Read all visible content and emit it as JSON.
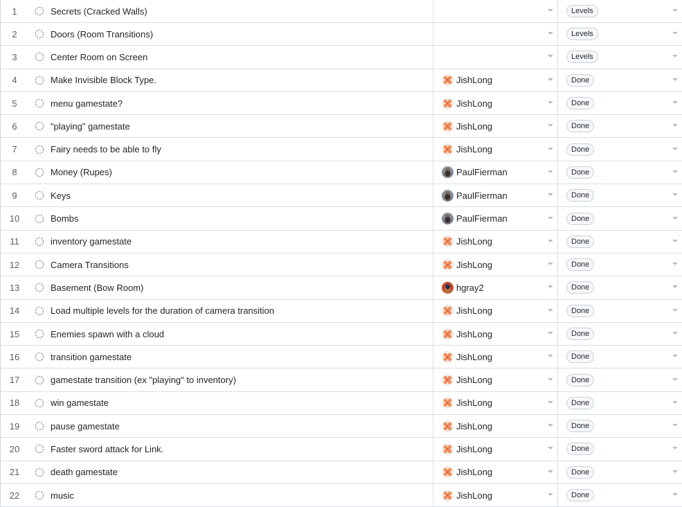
{
  "rows": [
    {
      "num": "1",
      "title": "Secrets (Cracked Walls)",
      "assignee": "",
      "avatar": "none",
      "status": "Levels"
    },
    {
      "num": "2",
      "title": "Doors (Room Transitions)",
      "assignee": "",
      "avatar": "none",
      "status": "Levels"
    },
    {
      "num": "3",
      "title": "Center Room on Screen",
      "assignee": "",
      "avatar": "none",
      "status": "Levels"
    },
    {
      "num": "4",
      "title": "Make Invisible Block Type.",
      "assignee": "JishLong",
      "avatar": "jish",
      "status": "Done"
    },
    {
      "num": "5",
      "title": "menu gamestate?",
      "assignee": "JishLong",
      "avatar": "jish",
      "status": "Done"
    },
    {
      "num": "6",
      "title": "\"playing\" gamestate",
      "assignee": "JishLong",
      "avatar": "jish",
      "status": "Done"
    },
    {
      "num": "7",
      "title": "Fairy needs to be able to fly",
      "assignee": "JishLong",
      "avatar": "jish",
      "status": "Done"
    },
    {
      "num": "8",
      "title": "Money (Rupes)",
      "assignee": "PaulFierman",
      "avatar": "paul",
      "status": "Done"
    },
    {
      "num": "9",
      "title": "Keys",
      "assignee": "PaulFierman",
      "avatar": "paul",
      "status": "Done"
    },
    {
      "num": "10",
      "title": "Bombs",
      "assignee": "PaulFierman",
      "avatar": "paul",
      "status": "Done"
    },
    {
      "num": "11",
      "title": "inventory gamestate",
      "assignee": "JishLong",
      "avatar": "jish",
      "status": "Done"
    },
    {
      "num": "12",
      "title": "Camera Transitions",
      "assignee": "JishLong",
      "avatar": "jish",
      "status": "Done"
    },
    {
      "num": "13",
      "title": "Basement (Bow Room)",
      "assignee": "hgray2",
      "avatar": "hgray",
      "status": "Done"
    },
    {
      "num": "14",
      "title": "Load multiple levels for the duration of camera transition",
      "assignee": "JishLong",
      "avatar": "jish",
      "status": "Done"
    },
    {
      "num": "15",
      "title": "Enemies spawn with a cloud",
      "assignee": "JishLong",
      "avatar": "jish",
      "status": "Done"
    },
    {
      "num": "16",
      "title": "transition gamestate",
      "assignee": "JishLong",
      "avatar": "jish",
      "status": "Done"
    },
    {
      "num": "17",
      "title": "gamestate transition (ex \"playing\" to inventory)",
      "assignee": "JishLong",
      "avatar": "jish",
      "status": "Done"
    },
    {
      "num": "18",
      "title": "win gamestate",
      "assignee": "JishLong",
      "avatar": "jish",
      "status": "Done"
    },
    {
      "num": "19",
      "title": "pause gamestate",
      "assignee": "JishLong",
      "avatar": "jish",
      "status": "Done"
    },
    {
      "num": "20",
      "title": "Faster sword attack for Link.",
      "assignee": "JishLong",
      "avatar": "jish",
      "status": "Done"
    },
    {
      "num": "21",
      "title": "death gamestate",
      "assignee": "JishLong",
      "avatar": "jish",
      "status": "Done"
    },
    {
      "num": "22",
      "title": "music",
      "assignee": "JishLong",
      "avatar": "jish",
      "status": "Done"
    }
  ],
  "icons": {
    "status": "draft-circle-icon",
    "dropdown": "chevron-down-icon"
  },
  "colors": {
    "draft_icon": "#6e7781",
    "border": "#d8dee4",
    "badge_border": "#c8d1da"
  }
}
